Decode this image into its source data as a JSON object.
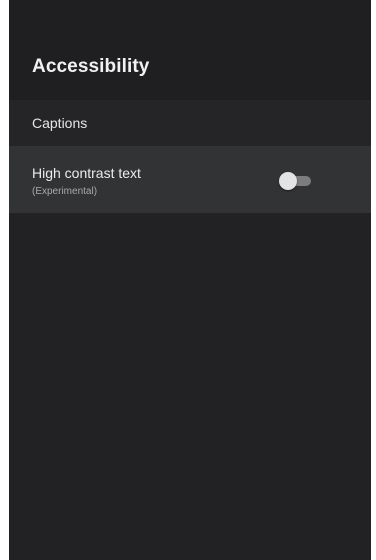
{
  "screen": {
    "title": "Accessibility"
  },
  "items": [
    {
      "label": "Captions"
    },
    {
      "label": "High contrast text",
      "sublabel": "(Experimental)",
      "toggle_on": false
    }
  ],
  "colors": {
    "background": "#222224",
    "header_background": "#1f1f21",
    "selected_row": "#323335",
    "text_primary": "#ececec",
    "text_secondary": "#a9a9ab",
    "toggle_track": "#7c7c7e",
    "toggle_thumb": "#e3e3e3"
  }
}
